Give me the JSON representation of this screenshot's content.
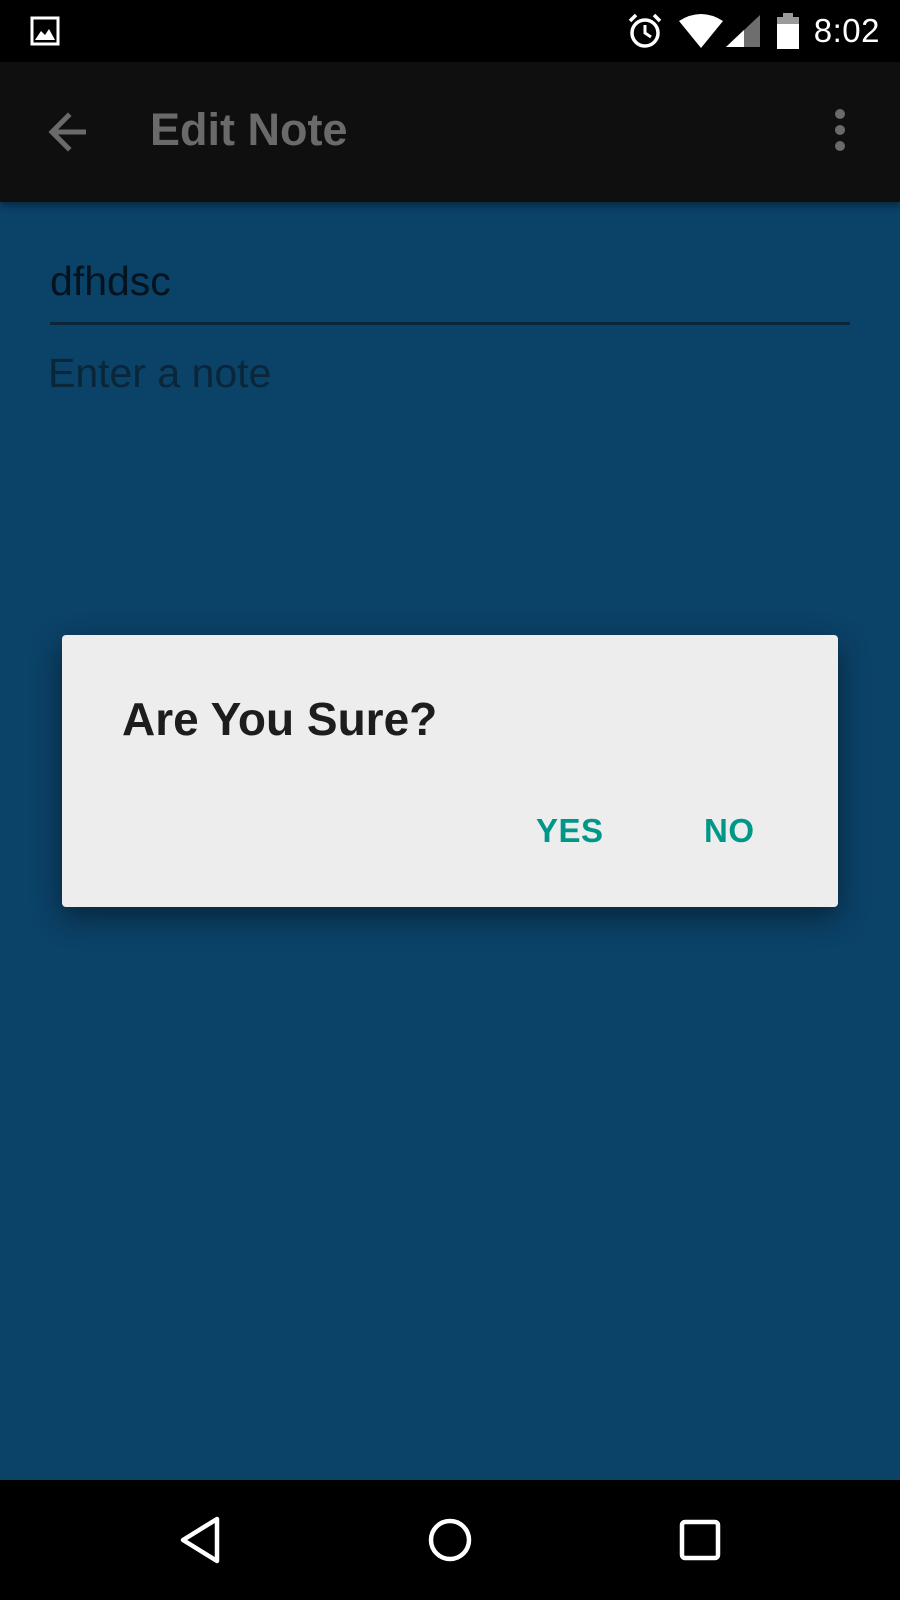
{
  "status_bar": {
    "time": "8:02",
    "icons": [
      "image-icon",
      "alarm-icon",
      "wifi-icon",
      "signal-icon",
      "battery-icon"
    ]
  },
  "toolbar": {
    "title": "Edit Note",
    "back_icon": "arrow-back-icon",
    "overflow_icon": "more-vert-icon"
  },
  "form": {
    "title_value": "dfhdsc",
    "note_placeholder": "Enter a note"
  },
  "dialog": {
    "title": "Are You Sure?",
    "yes_label": "YES",
    "no_label": "NO"
  },
  "nav_bar": {
    "icons": [
      "nav-back-icon",
      "nav-home-icon",
      "nav-recents-icon"
    ]
  },
  "colors": {
    "content_background": "#0b4268",
    "toolbar_background": "#0f0f0f",
    "dialog_background": "#ededed",
    "dialog_button": "#009688"
  }
}
